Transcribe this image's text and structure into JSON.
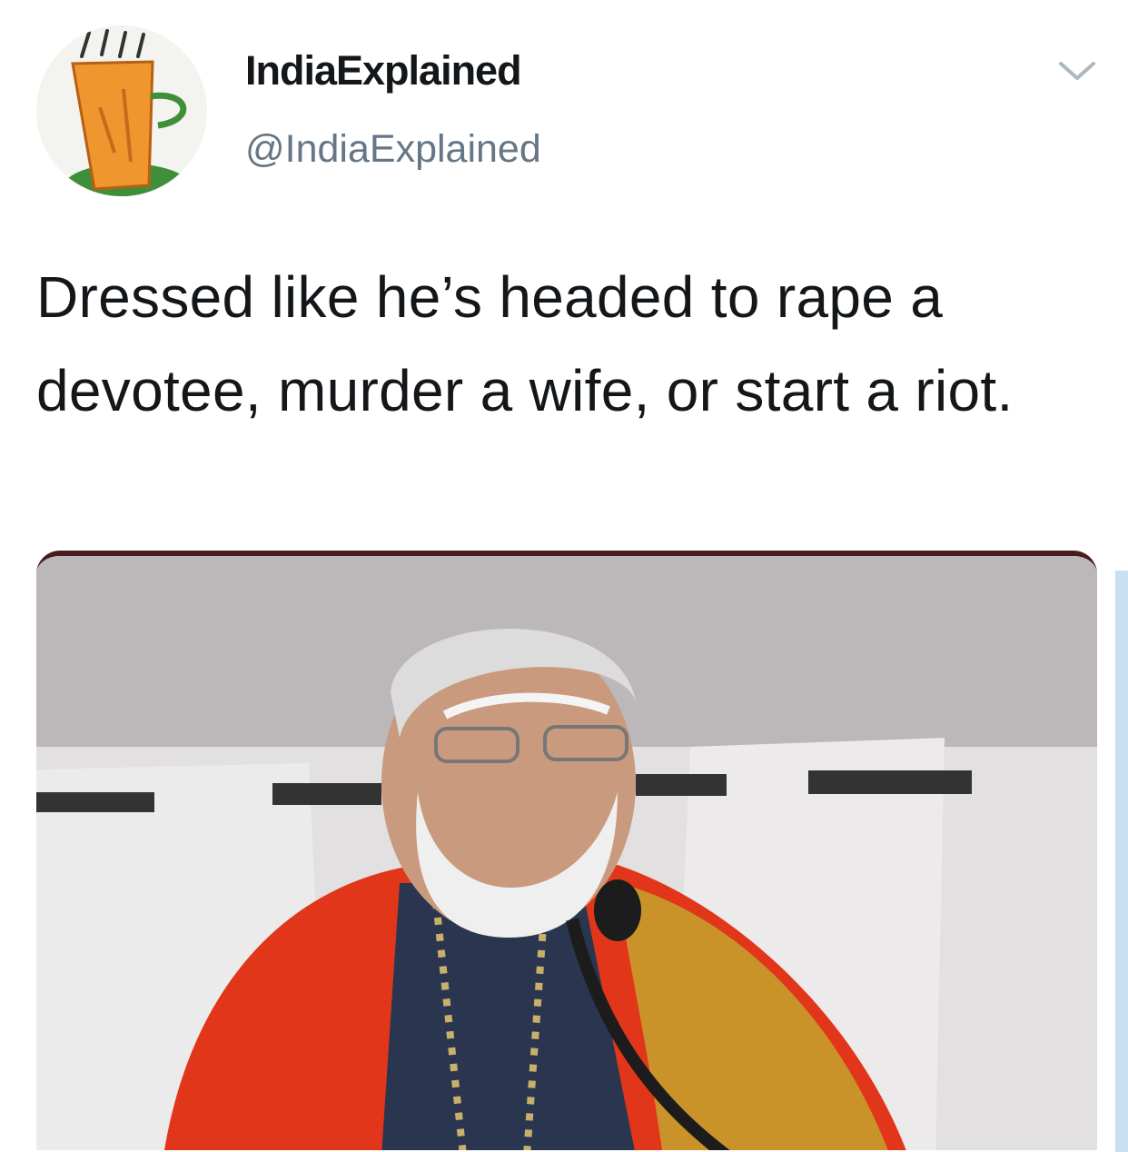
{
  "tweet": {
    "display_name": "IndiaExplained",
    "handle": "@IndiaExplained",
    "text": "Dressed like he’s headed to rape a devotee, murder a wife, or start a riot."
  },
  "icons": {
    "avatar": "tea-cup-drawing-icon",
    "menu": "chevron-down-icon"
  },
  "colors": {
    "text": "#14171a",
    "secondary": "#657786",
    "chevron": "#aab8c2"
  }
}
